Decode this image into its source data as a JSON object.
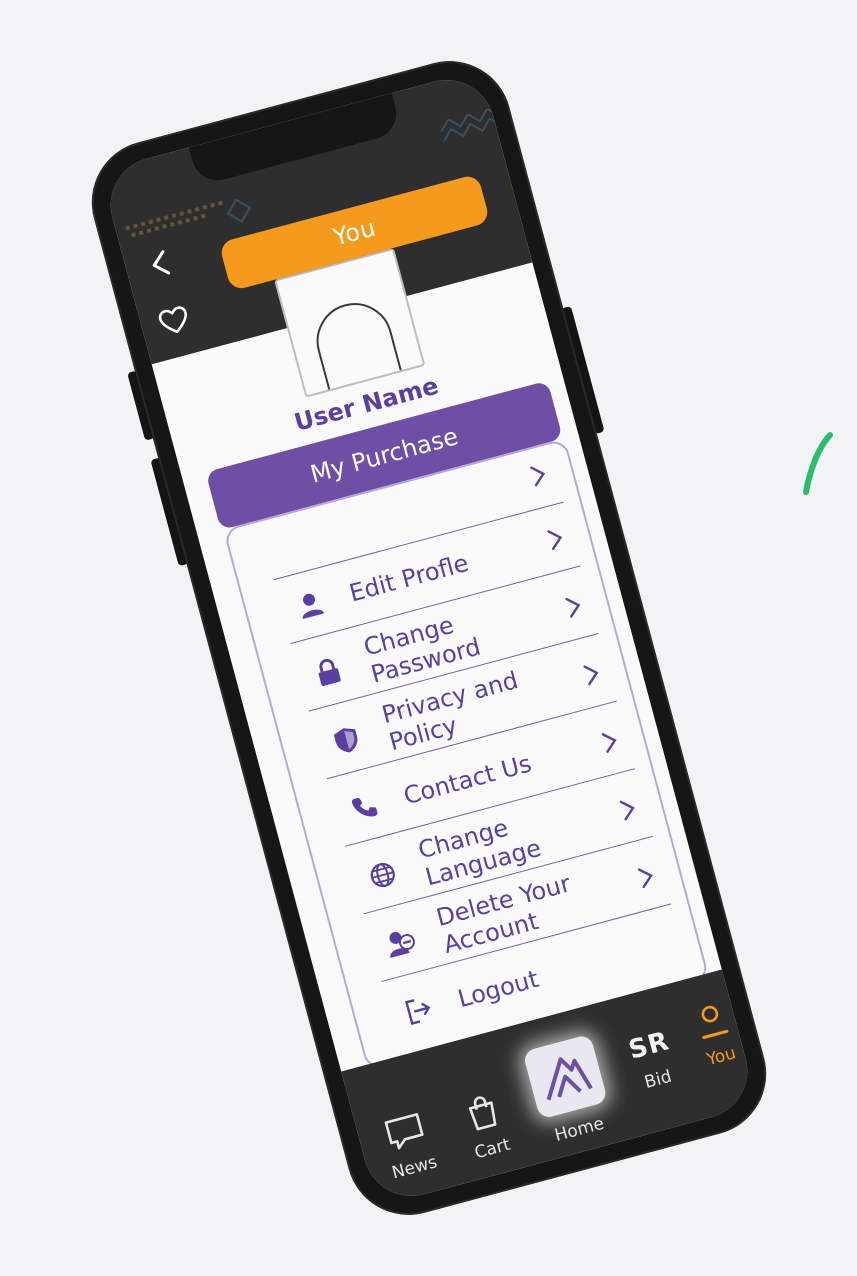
{
  "header": {
    "title": "You"
  },
  "profile": {
    "user_name": "User Name",
    "purchase_label": "My Purchase"
  },
  "menu": {
    "items": [
      {
        "label": "Edit Profle",
        "icon": "user-icon"
      },
      {
        "label": "Change Password",
        "icon": "lock-icon"
      },
      {
        "label": "Privacy and Policy",
        "icon": "shield-icon"
      },
      {
        "label": "Contact Us",
        "icon": "phone-icon"
      },
      {
        "label": "Change Language",
        "icon": "globe-icon"
      },
      {
        "label": "Delete Your Account",
        "icon": "delete-account-icon"
      },
      {
        "label": "Logout",
        "icon": "logout-icon"
      }
    ]
  },
  "tabs": [
    {
      "label": "News",
      "icon": "chat-icon"
    },
    {
      "label": "Cart",
      "icon": "bag-icon"
    },
    {
      "label": "Home",
      "icon": "logo-icon"
    },
    {
      "label": "Bid",
      "icon_text": "SR"
    },
    {
      "label": "You",
      "icon": "person-icon",
      "active": true
    }
  ],
  "colors": {
    "accent_orange": "#f49a1c",
    "brand_purple": "#6f4fa6",
    "header_dark": "#2e2e2e"
  }
}
